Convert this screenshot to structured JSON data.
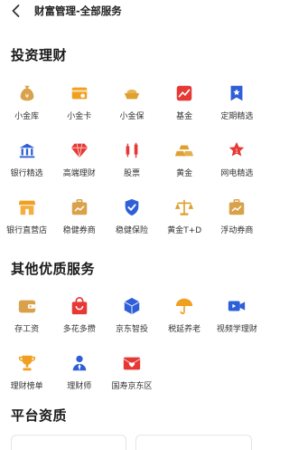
{
  "header": {
    "title": "财富管理-全部服务"
  },
  "sections": {
    "invest": {
      "title": "投资理财"
    },
    "other": {
      "title": "其他优质服务"
    },
    "platform": {
      "title": "平台资质"
    }
  },
  "invest_items": [
    {
      "label": "小金库",
      "icon": "money-bag-icon",
      "color": "#d9a24a"
    },
    {
      "label": "小金卡",
      "icon": "card-icon",
      "color": "#f0a020"
    },
    {
      "label": "小金保",
      "icon": "gold-ingot-icon",
      "color": "#e0a030"
    },
    {
      "label": "基金",
      "icon": "chart-icon",
      "color": "#e53935"
    },
    {
      "label": "定期精选",
      "icon": "bookmark-star-icon",
      "color": "#2f5fd8"
    },
    {
      "label": "银行精选",
      "icon": "bank-icon",
      "color": "#2f5fd8"
    },
    {
      "label": "高端理财",
      "icon": "diamond-icon",
      "color": "#e53935"
    },
    {
      "label": "股票",
      "icon": "candlestick-icon",
      "color": "#e53935"
    },
    {
      "label": "黄金",
      "icon": "gold-bars-icon",
      "color": "#e0a030"
    },
    {
      "label": "网电精选",
      "icon": "star-badge-icon",
      "color": "#e53935"
    },
    {
      "label": "银行直营店",
      "icon": "storefront-icon",
      "color": "#f0a020"
    },
    {
      "label": "稳健券商",
      "icon": "briefcase-chart-icon",
      "color": "#d9a24a"
    },
    {
      "label": "稳健保险",
      "icon": "shield-check-icon",
      "color": "#2f5fd8"
    },
    {
      "label": "黄金T+D",
      "icon": "scale-icon",
      "color": "#e0a030"
    },
    {
      "label": "浮动券商",
      "icon": "briefcase-chart-icon",
      "color": "#d9a24a"
    }
  ],
  "other_items": [
    {
      "label": "存工资",
      "icon": "wallet-icon",
      "color": "#d9a24a"
    },
    {
      "label": "多花多攒",
      "icon": "shopping-bag-icon",
      "color": "#e53935"
    },
    {
      "label": "京东智投",
      "icon": "cube-icon",
      "color": "#2f5fd8"
    },
    {
      "label": "税延养老",
      "icon": "umbrella-icon",
      "color": "#f0a020"
    },
    {
      "label": "视频学理财",
      "icon": "video-camera-icon",
      "color": "#2f5fd8"
    },
    {
      "label": "理财榜单",
      "icon": "trophy-icon",
      "color": "#f0a020"
    },
    {
      "label": "理财师",
      "icon": "advisor-icon",
      "color": "#2f5fd8"
    },
    {
      "label": "国寿京东区",
      "icon": "envelope-heart-icon",
      "color": "#e53935"
    }
  ],
  "platform": {
    "cards": [
      {
        "text": ""
      },
      {
        "text": ""
      }
    ]
  }
}
